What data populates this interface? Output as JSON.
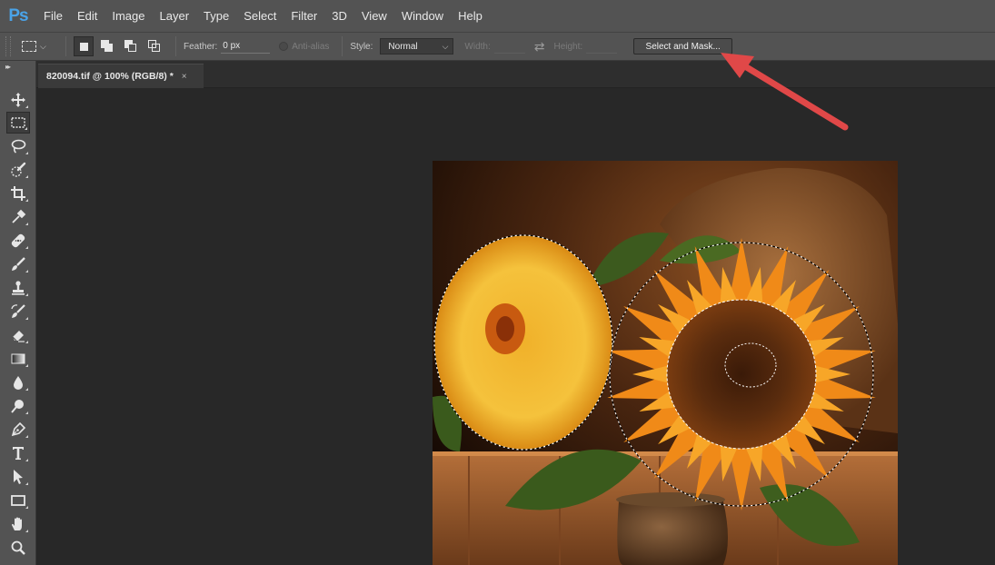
{
  "app": {
    "logo": "Ps"
  },
  "menu": [
    "File",
    "Edit",
    "Image",
    "Layer",
    "Type",
    "Select",
    "Filter",
    "3D",
    "View",
    "Window",
    "Help"
  ],
  "options": {
    "feather_label": "Feather:",
    "feather_value": "0 px",
    "antialias_label": "Anti-alias",
    "style_label": "Style:",
    "style_value": "Normal",
    "width_label": "Width:",
    "height_label": "Height:",
    "select_mask_label": "Select and Mask..."
  },
  "document": {
    "tab_title": "820094.tif @ 100% (RGB/8) *",
    "close_glyph": "×"
  },
  "tools": [
    "move-icon",
    "rectangular-marquee-icon",
    "lasso-icon",
    "quick-selection-icon",
    "crop-icon",
    "eyedropper-icon",
    "healing-brush-icon",
    "brush-icon",
    "clone-stamp-icon",
    "history-brush-icon",
    "eraser-icon",
    "gradient-icon",
    "blur-icon",
    "dodge-icon",
    "pen-icon",
    "type-icon",
    "path-selection-icon",
    "rectangle-icon",
    "hand-icon",
    "zoom-icon"
  ],
  "colors": {
    "accent_arrow": "#e04848",
    "ps_blue": "#4aa3e8"
  }
}
